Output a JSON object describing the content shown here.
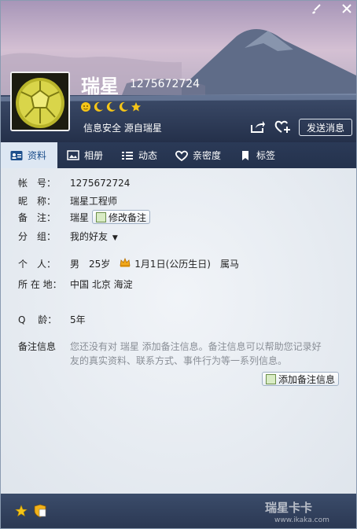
{
  "window": {
    "name": "瑞星",
    "account_number": "1275672724",
    "security_text": "信息安全 源自瑞星",
    "send_message_label": "发送消息"
  },
  "tabs": [
    {
      "label": "资料",
      "icon": "profile-card-icon"
    },
    {
      "label": "相册",
      "icon": "photo-album-icon"
    },
    {
      "label": "动态",
      "icon": "feed-list-icon"
    },
    {
      "label": "亲密度",
      "icon": "heart-icon"
    },
    {
      "label": "标签",
      "icon": "bookmark-icon"
    }
  ],
  "profile": {
    "account_label": "帐　号：",
    "account_value": "1275672724",
    "nickname_label": "昵　称：",
    "nickname_value": "瑞星工程师",
    "remark_label": "备　注：",
    "remark_value": "瑞星",
    "edit_remark_label": "修改备注",
    "group_label": "分　组：",
    "group_value": "我的好友",
    "person_label": "个　人：",
    "gender": "男",
    "age": "25岁",
    "birthday": "1月1日(公历生日)",
    "zodiac": "属马",
    "location_label": "所 在 地：",
    "location_value": "中国 北京 海淀",
    "qq_age_label": "Q　 龄：",
    "qq_age_value": "5年",
    "remark_info_label": "备注信息",
    "remark_info_text": "您还没有对 瑞星 添加备注信息。备注信息可以帮助您记录好友的真实资料、联系方式、事件行为等一系列信息。",
    "add_remark_label": "添加备注信息"
  },
  "footer": {
    "watermark_title": "瑞星卡卡",
    "watermark_url": "www.ikaka.com"
  },
  "colors": {
    "tab_bar": "#2b3a57",
    "active_tab": "#dde7f3",
    "body_bg": "#e9eef4"
  }
}
